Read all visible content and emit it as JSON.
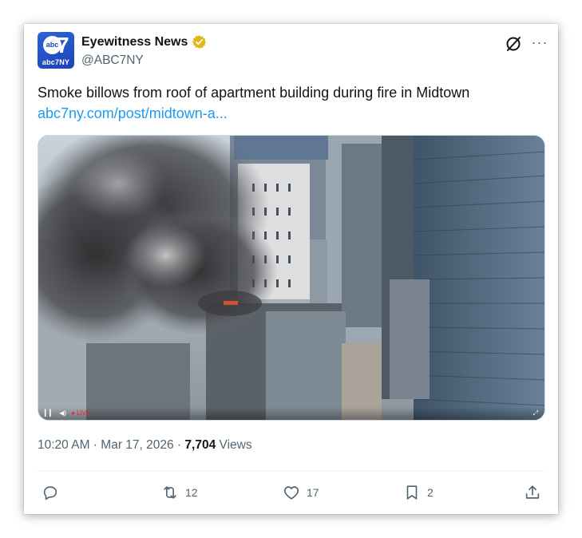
{
  "account": {
    "name": "Eyewitness News",
    "handle": "@ABC7NY",
    "avatar_ball_text": "abc",
    "avatar_number": "7",
    "avatar_sub": "abc7NY",
    "verified_color": "#e2b719"
  },
  "post": {
    "text": "Smoke billows from roof of apartment building during fire in Midtown",
    "link": "abc7ny.com/post/midtown-a..."
  },
  "media": {
    "type": "video",
    "controls": {
      "play": "▎▎",
      "volume": "◀)",
      "live": "● LIVE"
    }
  },
  "meta": {
    "time": "10:20 AM",
    "separator1": " · ",
    "date": "Mar 17, 2026",
    "separator2": " · ",
    "views_count": "7,704",
    "views_label": " Views"
  },
  "actions": {
    "reply_count": "",
    "repost_count": "12",
    "like_count": "17",
    "bookmark_count": "2"
  },
  "colors": {
    "link": "#1d9bf0",
    "muted": "#536471",
    "text": "#0f1419"
  }
}
